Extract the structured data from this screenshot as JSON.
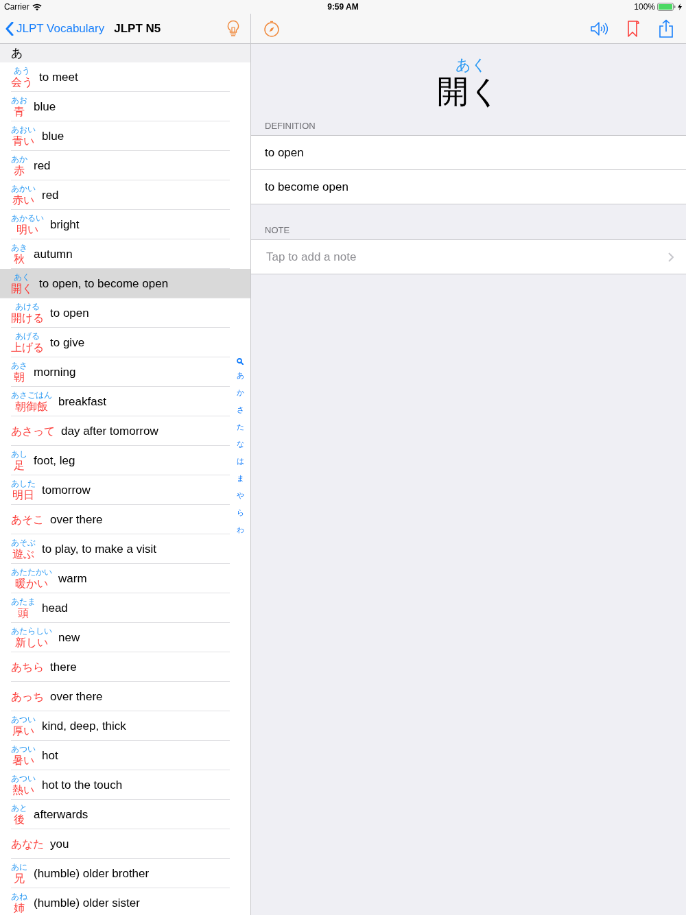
{
  "status_bar": {
    "carrier": "Carrier",
    "time": "9:59 AM",
    "battery": "100%"
  },
  "list_nav": {
    "back": "JLPT Vocabulary",
    "title": "JLPT N5"
  },
  "section": "あ",
  "entries": [
    {
      "reading": "あう",
      "word": "会う",
      "meaning": "to meet",
      "selected": false
    },
    {
      "reading": "あお",
      "word": "青",
      "meaning": "blue",
      "selected": false
    },
    {
      "reading": "あおい",
      "word": "青い",
      "meaning": "blue",
      "selected": false
    },
    {
      "reading": "あか",
      "word": "赤",
      "meaning": "red",
      "selected": false
    },
    {
      "reading": "あかい",
      "word": "赤い",
      "meaning": "red",
      "selected": false
    },
    {
      "reading": "あかるい",
      "word": "明い",
      "meaning": "bright",
      "selected": false
    },
    {
      "reading": "あき",
      "word": "秋",
      "meaning": "autumn",
      "selected": false
    },
    {
      "reading": "あく",
      "word": "開く",
      "meaning": "to open, to become open",
      "selected": true
    },
    {
      "reading": "あける",
      "word": "開ける",
      "meaning": "to open",
      "selected": false
    },
    {
      "reading": "あげる",
      "word": "上げる",
      "meaning": "to give",
      "selected": false
    },
    {
      "reading": "あさ",
      "word": "朝",
      "meaning": "morning",
      "selected": false
    },
    {
      "reading": "あさごはん",
      "word": "朝御飯",
      "meaning": "breakfast",
      "selected": false
    },
    {
      "word": "あさって",
      "meaning": "day after tomorrow",
      "selected": false
    },
    {
      "reading": "あし",
      "word": "足",
      "meaning": "foot, leg",
      "selected": false
    },
    {
      "reading": "あした",
      "word": "明日",
      "meaning": "tomorrow",
      "selected": false
    },
    {
      "word": "あそこ",
      "meaning": "over there",
      "selected": false
    },
    {
      "reading": "あそぶ",
      "word": "遊ぶ",
      "meaning": "to play, to make a visit",
      "selected": false
    },
    {
      "reading": "あたたかい",
      "word": "暖かい",
      "meaning": "warm",
      "selected": false
    },
    {
      "reading": "あたま",
      "word": "頭",
      "meaning": "head",
      "selected": false
    },
    {
      "reading": "あたらしい",
      "word": "新しい",
      "meaning": "new",
      "selected": false
    },
    {
      "word": "あちら",
      "meaning": "there",
      "selected": false
    },
    {
      "word": "あっち",
      "meaning": "over there",
      "selected": false
    },
    {
      "reading": "あつい",
      "word": "厚い",
      "meaning": "kind, deep, thick",
      "selected": false
    },
    {
      "reading": "あつい",
      "word": "暑い",
      "meaning": "hot",
      "selected": false
    },
    {
      "reading": "あつい",
      "word": "熱い",
      "meaning": "hot to the touch",
      "selected": false
    },
    {
      "reading": "あと",
      "word": "後",
      "meaning": "afterwards",
      "selected": false
    },
    {
      "word": "あなた",
      "meaning": "you",
      "selected": false
    },
    {
      "reading": "あに",
      "word": "兄",
      "meaning": "(humble) older brother",
      "selected": false
    },
    {
      "reading": "あね",
      "word": "姉",
      "meaning": "(humble) older sister",
      "selected": false
    }
  ],
  "index": [
    "あ",
    "か",
    "さ",
    "た",
    "な",
    "は",
    "ま",
    "や",
    "ら",
    "わ"
  ],
  "detail": {
    "reading": "あく",
    "word": "開く",
    "definition_label": "DEFINITION",
    "definitions": [
      "to open",
      "to become open"
    ],
    "note_label": "NOTE",
    "note": {
      "placeholder": "Tap to add a note"
    }
  }
}
